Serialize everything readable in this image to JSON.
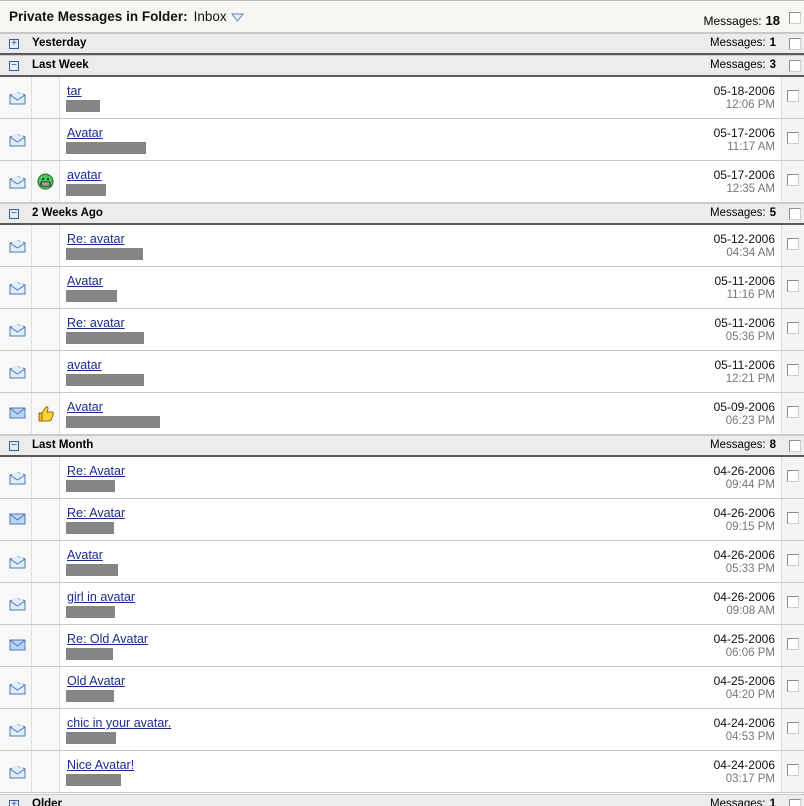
{
  "header": {
    "title": "Private Messages in Folder:",
    "folder": "Inbox",
    "messages_label": "Messages:",
    "total": "18"
  },
  "groups": [
    {
      "label": "Yesterday",
      "toggle": "+",
      "messages_label": "Messages:",
      "count": "1"
    },
    {
      "label": "Last Week",
      "toggle": "−",
      "messages_label": "Messages:",
      "count": "3"
    },
    {
      "label": "2 Weeks Ago",
      "toggle": "−",
      "messages_label": "Messages:",
      "count": "5"
    },
    {
      "label": "Last Month",
      "toggle": "−",
      "messages_label": "Messages:",
      "count": "8"
    },
    {
      "label": "Older",
      "toggle": "+",
      "messages_label": "Messages:",
      "count": "1"
    }
  ],
  "messages": [
    {
      "subject": "tar",
      "date": "05-18-2006",
      "time": "12:06 PM",
      "status": "read-icon",
      "icon": ""
    },
    {
      "subject": "Avatar",
      "date": "05-17-2006",
      "time": "11:17 AM",
      "status": "read-icon",
      "icon": ""
    },
    {
      "subject": "avatar",
      "date": "05-17-2006",
      "time": "12:35 AM",
      "status": "read-icon",
      "icon": "grin-smiley-icon"
    },
    {
      "subject": "Re: avatar",
      "date": "05-12-2006",
      "time": "04:34 AM",
      "status": "read-icon",
      "icon": ""
    },
    {
      "subject": "Avatar",
      "date": "05-11-2006",
      "time": "11:16 PM",
      "status": "read-icon",
      "icon": ""
    },
    {
      "subject": "Re: avatar",
      "date": "05-11-2006",
      "time": "05:36 PM",
      "status": "read-icon",
      "icon": ""
    },
    {
      "subject": "avatar",
      "date": "05-11-2006",
      "time": "12:21 PM",
      "status": "read-icon",
      "icon": ""
    },
    {
      "subject": "Avatar",
      "date": "05-09-2006",
      "time": "06:23 PM",
      "status": "closed-envelope-icon",
      "icon": "thumbs-up-icon"
    },
    {
      "subject": "Re: Avatar",
      "date": "04-26-2006",
      "time": "09:44 PM",
      "status": "read-icon",
      "icon": ""
    },
    {
      "subject": "Re: Avatar",
      "date": "04-26-2006",
      "time": "09:15 PM",
      "status": "closed-envelope-icon",
      "icon": ""
    },
    {
      "subject": "Avatar",
      "date": "04-26-2006",
      "time": "05:33 PM",
      "status": "read-icon",
      "icon": ""
    },
    {
      "subject": "girl in avatar",
      "date": "04-26-2006",
      "time": "09:08 AM",
      "status": "read-icon",
      "icon": ""
    },
    {
      "subject": "Re: Old Avatar",
      "date": "04-25-2006",
      "time": "06:06 PM",
      "status": "closed-envelope-icon",
      "icon": ""
    },
    {
      "subject": "Old Avatar",
      "date": "04-25-2006",
      "time": "04:20 PM",
      "status": "read-icon",
      "icon": ""
    },
    {
      "subject": "chic in your avatar.",
      "date": "04-24-2006",
      "time": "04:53 PM",
      "status": "read-icon",
      "icon": ""
    },
    {
      "subject": "Nice Avatar!",
      "date": "04-24-2006",
      "time": "03:17 PM",
      "status": "read-icon",
      "icon": ""
    }
  ]
}
